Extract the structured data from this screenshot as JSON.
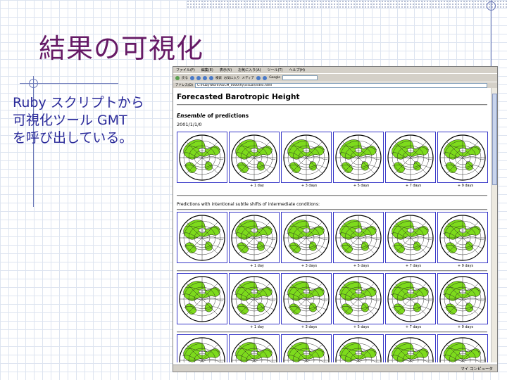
{
  "slide": {
    "title": "結果の可視化",
    "body": "Ruby スクリプトから\n可視化ツール GMT\nを呼び出している。"
  },
  "browser": {
    "menu": [
      "ファイル(F)",
      "編集(E)",
      "表示(V)",
      "お気に入り(A)",
      "ツール(T)",
      "ヘルプ(H)"
    ],
    "toolbar": {
      "back": "戻る",
      "search": "検索",
      "favorites": "お気に入り",
      "media": "メディア",
      "google": "Google"
    },
    "address_label": "アドレス(D)",
    "address": "C:\\Ruby\\Work\\AGCM_0000\\fly\\visual\\index.html",
    "status": "マイ コンピュータ"
  },
  "page": {
    "title": "Forecasted Barotropic Height",
    "ensemble_italic": "Ensemble",
    "ensemble_rest": " of predictions",
    "date": "2001/1/1/0",
    "section": "Predictions with intentional subtle shifts of intermediate conditions:",
    "day_labels": [
      "+ 1 day",
      "+ 3 days",
      "+ 5 days",
      "+ 7 days",
      "+ 9 days"
    ]
  },
  "colors": {
    "title": "#661a66",
    "body_text": "#2a2a9a",
    "land": "#7ddb1c",
    "grid_line": "#6a78b8",
    "cell_border": "#3838c8"
  }
}
